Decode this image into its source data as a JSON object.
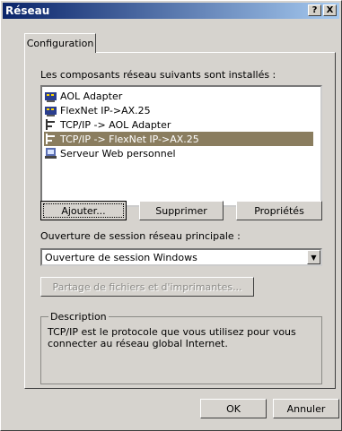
{
  "window": {
    "title": "Réseau",
    "help_label": "?",
    "close_label": "X"
  },
  "tabs": [
    {
      "label": "Configuration"
    }
  ],
  "components": {
    "label": "Les composants réseau suivants sont installés :",
    "items": [
      {
        "label": "AOL Adapter",
        "icon": "network-adapter-icon"
      },
      {
        "label": "FlexNet IP->AX.25",
        "icon": "network-adapter-icon"
      },
      {
        "label": "TCP/IP -> AOL Adapter",
        "icon": "protocol-icon"
      },
      {
        "label": "TCP/IP -> FlexNet IP->AX.25",
        "icon": "protocol-icon",
        "selected": true
      },
      {
        "label": "Serveur Web personnel",
        "icon": "service-icon"
      }
    ]
  },
  "buttons": {
    "add": "Ajouter...",
    "remove": "Supprimer",
    "properties": "Propriétés"
  },
  "logon": {
    "label": "Ouverture de session réseau principale :",
    "value": "Ouverture de session Windows"
  },
  "sharing_button": "Partage de fichiers et d'imprimantes...",
  "description": {
    "legend": "Description",
    "text": "TCP/IP est le protocole que vous utilisez pour vous connecter au réseau global Internet."
  },
  "footer": {
    "ok": "OK",
    "cancel": "Annuler"
  },
  "colors": {
    "title_start": "#0a246a",
    "title_end": "#a6caf0",
    "selection": "#8a7d5f"
  }
}
